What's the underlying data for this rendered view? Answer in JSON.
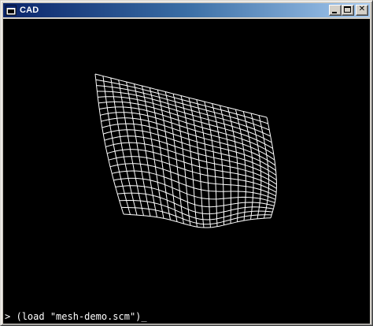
{
  "window": {
    "title": "CAD",
    "close_glyph": "✕"
  },
  "console": {
    "prompt": ">",
    "command": "(load \"mesh-demo.scm\")",
    "cursor": "_"
  },
  "mesh": {
    "color": "#ffffff",
    "background": "#000000",
    "rows": 22,
    "cols": 22
  },
  "colors": {
    "titlebar_start": "#0a246a",
    "titlebar_end": "#a6caf0",
    "chrome": "#d4d0c8"
  }
}
